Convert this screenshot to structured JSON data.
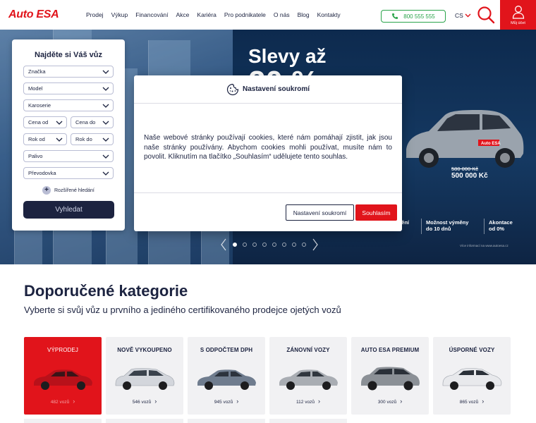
{
  "header": {
    "logo": "Auto ESA",
    "nav": [
      "Prodej",
      "Výkup",
      "Financování",
      "Akce",
      "Kariéra",
      "Pro podnikatele",
      "O nás",
      "Blog",
      "Kontakty"
    ],
    "phone": "800 555 555",
    "lang": "CS",
    "account_label": "Můj účet"
  },
  "hero": {
    "title": "Slevy až",
    "big": "20 %",
    "price_old": "580 000 Kč",
    "price_new": "500 000 Kč",
    "perks": [
      "Zdarma pojištění\nodrní",
      "Možnost výměny\ndo 10 dnů",
      "Akontace\nod 0%"
    ],
    "note": "Více informací na www.autoesa.cz",
    "slides": 8,
    "active_slide": 1
  },
  "search": {
    "title": "Najděte si Váš vůz",
    "fields": {
      "brand": "Značka",
      "model": "Model",
      "body": "Karoserie",
      "price_from": "Cena od",
      "price_to": "Cena do",
      "year_from": "Rok od",
      "year_to": "Rok do",
      "fuel": "Palivo",
      "gearbox": "Převodovka"
    },
    "advanced": "Rozšířené hledání",
    "submit": "Vyhledat"
  },
  "cookie_modal": {
    "title": "Nastavení soukromí",
    "body": "Naše webové stránky používají cookies, které nám pomáhají zjistit, jak jsou naše stránky používány. Abychom cookies mohli používat, musíte nám to povolit. Kliknutím na tlačítko „Souhlasím“ udělujete tento souhlas.",
    "settings_btn": "Nastavení soukromí",
    "accept_btn": "Souhlasím"
  },
  "categories": {
    "title": "Doporučené kategorie",
    "subtitle": "Vyberte si svůj vůz u prvního a jediného certifikovaného prodejce ojetých vozů",
    "items": [
      {
        "label": "VÝPRODEJ",
        "count": "482 vozů",
        "car_color": "#c8141b"
      },
      {
        "label": "NOVĚ VYKOUPENO",
        "count": "546 vozů",
        "car_color": "#d9dbe0"
      },
      {
        "label": "S ODPOČTEM DPH",
        "count": "945 vozů",
        "car_color": "#6f7c8e"
      },
      {
        "label": "ZÁNOVNÍ VOZY",
        "count": "112 vozů",
        "car_color": "#a9adb3"
      },
      {
        "label": "AUTO ESA PREMIUM",
        "count": "300 vozů",
        "car_color": "#8b9096"
      },
      {
        "label": "ÚSPORNÉ VOZY",
        "count": "865 vozů",
        "car_color": "#e8e9ec"
      }
    ]
  },
  "colors": {
    "brand_red": "#e1141b",
    "navy": "#1c2340",
    "phone_green": "#2aa44a"
  }
}
